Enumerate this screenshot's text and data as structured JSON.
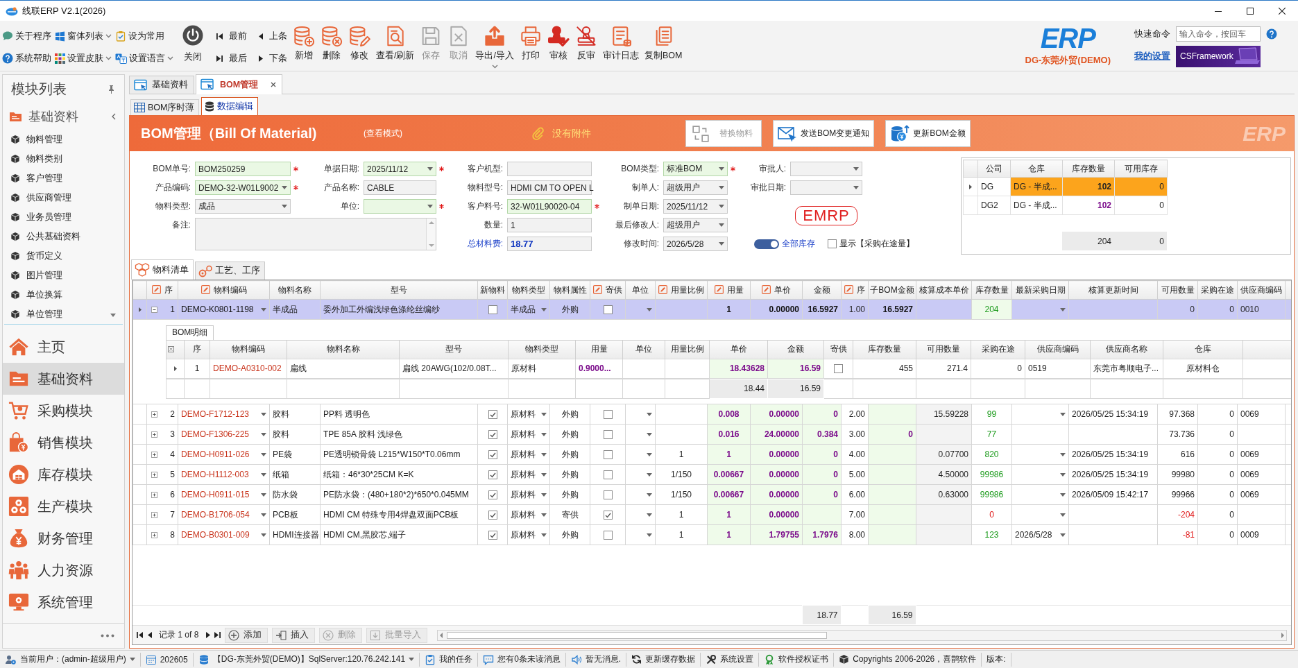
{
  "window": {
    "title": "线联ERP V2.1(2026)"
  },
  "toolbar": {
    "quick_items": [
      {
        "label": "关于程序",
        "dropdown": false
      },
      {
        "label": "窗体列表",
        "dropdown": true
      },
      {
        "label": "设为常用",
        "dropdown": false
      },
      {
        "label": "系统帮助",
        "dropdown": false
      },
      {
        "label": "设置皮肤",
        "dropdown": true
      },
      {
        "label": "设置语言",
        "dropdown": true
      }
    ],
    "close_label": "关闭",
    "navigation": [
      "最前",
      "上条",
      "最后",
      "下条"
    ],
    "actions": [
      {
        "label": "新增",
        "disabled": false,
        "dropdown": false
      },
      {
        "label": "删除",
        "disabled": false,
        "dropdown": false
      },
      {
        "label": "修改",
        "disabled": false,
        "dropdown": false
      },
      {
        "label": "查看/刷新",
        "disabled": false,
        "dropdown": false
      },
      {
        "label": "保存",
        "disabled": true,
        "dropdown": false
      },
      {
        "label": "取消",
        "disabled": true,
        "dropdown": false
      },
      {
        "label": "导出/导入",
        "disabled": false,
        "dropdown": true
      },
      {
        "label": "打印",
        "disabled": false,
        "dropdown": false
      },
      {
        "label": "审核",
        "disabled": false,
        "dropdown": false
      },
      {
        "label": "反审",
        "disabled": false,
        "dropdown": false
      },
      {
        "label": "审计日志",
        "disabled": false,
        "dropdown": false
      },
      {
        "label": "复制BOM",
        "disabled": false,
        "dropdown": false
      }
    ],
    "logo": "ERP",
    "company": "DG-东莞外贸(DEMO)",
    "command_label": "快速命令",
    "command_placeholder": "输入命令，按回车",
    "settings_link": "我的设置",
    "banner": "CSFramework"
  },
  "sidebar": {
    "title": "模块列表",
    "group": "基础资料",
    "items": [
      "物料管理",
      "物料类别",
      "客户管理",
      "供应商管理",
      "业务员管理",
      "公共基础资料",
      "货币定义",
      "图片管理",
      "单位换算",
      "单位管理"
    ],
    "modules": [
      {
        "label": "主页",
        "selected": false
      },
      {
        "label": "基础资料",
        "selected": true
      },
      {
        "label": "采购模块",
        "selected": false
      },
      {
        "label": "销售模块",
        "selected": false
      },
      {
        "label": "库存模块",
        "selected": false
      },
      {
        "label": "生产模块",
        "selected": false
      },
      {
        "label": "财务管理",
        "selected": false
      },
      {
        "label": "人力资源",
        "selected": false
      },
      {
        "label": "系统管理",
        "selected": false
      }
    ]
  },
  "document_tabs": [
    {
      "label": "基础资料",
      "selected": false,
      "closable": false
    },
    {
      "label": "BOM管理",
      "selected": true,
      "closable": true
    }
  ],
  "view_tabs": [
    {
      "label": "BOM序时薄",
      "selected": false
    },
    {
      "label": "数据编辑",
      "selected": true
    }
  ],
  "header": {
    "title": "BOM管理（Bill Of Material)",
    "mode": "(查看模式)",
    "attachment": "没有附件",
    "buttons": [
      {
        "label": "替换物料",
        "disabled": true
      },
      {
        "label": "发送BOM变更通知",
        "disabled": false
      },
      {
        "label": "更新BOM金额",
        "disabled": false
      }
    ],
    "watermark": "ERP"
  },
  "form": {
    "columns": [
      [
        {
          "label": "BOM单号:",
          "value": "BOM250259",
          "kind": "text",
          "required": true
        },
        {
          "label": "产品编码:",
          "value": "DEMO-32-W01L9002",
          "kind": "select",
          "required": true
        },
        {
          "label": "物料类型:",
          "value": "成品",
          "kind": "select",
          "required": false
        },
        {
          "label": "备注:",
          "kind": "memo",
          "required": false
        }
      ],
      [
        {
          "label": "单据日期:",
          "value": "2025/11/12",
          "kind": "select",
          "required": true
        },
        {
          "label": "产品名称:",
          "value": "CABLE",
          "kind": "text",
          "required": false
        },
        {
          "label": "单位:",
          "kind": "select",
          "required": true
        }
      ],
      [
        {
          "label": "客户机型:",
          "kind": "text",
          "required": false
        },
        {
          "label": "物料型号:",
          "value": "HDMI CM TO OPEN L",
          "kind": "text",
          "required": false
        },
        {
          "label": "客户料号:",
          "value": "32-W01L90020-04",
          "kind": "text",
          "required": true
        },
        {
          "label": "数量:",
          "value": "1",
          "kind": "text",
          "required": false
        },
        {
          "label": "总材料费:",
          "value": "18.77",
          "kind": "total",
          "required": false
        }
      ],
      [
        {
          "label": "BOM类型:",
          "value": "标准BOM",
          "kind": "select",
          "required": true
        },
        {
          "label": "制单人:",
          "value": "超级用户",
          "kind": "select",
          "required": false
        },
        {
          "label": "制单日期:",
          "value": "2025/11/12",
          "kind": "select",
          "required": false
        },
        {
          "label": "最后修改人:",
          "value": "超级用户",
          "kind": "select",
          "required": false
        },
        {
          "label": "修改时间:",
          "value": "2026/5/28",
          "kind": "select",
          "required": false
        }
      ],
      [
        {
          "label": "审批人:",
          "kind": "select",
          "required": false
        },
        {
          "label": "审批日期:",
          "kind": "select",
          "required": false
        }
      ]
    ],
    "logo": "EMRP",
    "stock_toggle": {
      "label": "全部库存",
      "on": true
    },
    "transit_checkbox": {
      "label": "显示【采购在途量】",
      "checked": false
    }
  },
  "stock": {
    "columns": [
      "公司",
      "仓库",
      "库存数量",
      "可用库存"
    ],
    "rows": [
      {
        "company": "DG",
        "warehouse": "DG - 半成...",
        "quantity": "102",
        "available": "0",
        "selected": true
      },
      {
        "company": "DG2",
        "warehouse": "DG - 半成...",
        "quantity": "102",
        "available": "0",
        "selected": false
      }
    ],
    "totals": {
      "quantity": "204",
      "available": "0"
    }
  },
  "grid_tabs": [
    {
      "label": "物料清单",
      "selected": true
    },
    {
      "label": "工艺、工序",
      "selected": false
    }
  ],
  "materials": {
    "columns": [
      {
        "label": "序",
        "editable": true
      },
      {
        "label": "物料编码",
        "editable": true
      },
      {
        "label": "物料名称",
        "editable": false
      },
      {
        "label": "型号",
        "editable": false
      },
      {
        "label": "新物料",
        "editable": false
      },
      {
        "label": "物料类型",
        "editable": false
      },
      {
        "label": "物料属性",
        "editable": false
      },
      {
        "label": "寄供",
        "editable": true
      },
      {
        "label": "单位",
        "editable": false
      },
      {
        "label": "用量比例",
        "editable": true
      },
      {
        "label": "用量",
        "editable": true
      },
      {
        "label": "单价",
        "editable": true
      },
      {
        "label": "金额",
        "editable": false
      },
      {
        "label": "序",
        "editable": true
      },
      {
        "label": "子BOM金额",
        "editable": false
      },
      {
        "label": "核算成本单价",
        "editable": false
      },
      {
        "label": "库存数量",
        "editable": false
      },
      {
        "label": "最新采购日期",
        "editable": false
      },
      {
        "label": "核算更新时间",
        "editable": false
      },
      {
        "label": "可用数量",
        "editable": false
      },
      {
        "label": "采购在途",
        "editable": false
      },
      {
        "label": "供应商编码",
        "editable": false
      }
    ],
    "rows": [
      {
        "seq": "1",
        "code": "DEMO-K0801-1198",
        "name": "半成品",
        "model": "委外加工外编浅绿色涤纶丝编纱",
        "new_material": false,
        "type": "半成品",
        "attribute": "外购",
        "consigned": false,
        "qty": "1",
        "price": "0.00000",
        "amount": "16.5927",
        "order": "1.00",
        "sub_bom_amount": "16.5927",
        "stock": "204",
        "available": "0",
        "in_transit": "0",
        "supplier_code": "0010",
        "stock_alert": false,
        "available_alert": false,
        "date_picker": true,
        "selected": true,
        "expanded": true,
        "details": {
          "tab": "BOM明细",
          "columns": [
            "序",
            "物料编码",
            "物料名称",
            "型号",
            "物料类型",
            "用量",
            "单位",
            "用量比例",
            "单价",
            "金额",
            "寄供",
            "库存数量",
            "可用数量",
            "采购在途",
            "供应商编码",
            "供应商名称",
            "仓库"
          ],
          "rows": [
            {
              "seq": "1",
              "code": "DEMO-A0310-002",
              "name": "扁线",
              "model": "扁线 20AWG(102/0.08T...",
              "type": "原材料",
              "qty": "0.9000...",
              "price": "18.43628",
              "amount": "16.59",
              "consigned": false,
              "stock": "455",
              "available": "271.4",
              "in_transit": "0",
              "supplier_code": "0519",
              "supplier_name": "东莞市粤顺电子...",
              "warehouse": "原材料仓",
              "selected": true
            }
          ],
          "totals": {
            "price": "18.44",
            "amount": "16.59"
          }
        }
      },
      {
        "seq": "2",
        "code": "DEMO-F1712-123",
        "name": "胶料",
        "model": "PP料 透明色",
        "new_material": true,
        "type": "原材料",
        "attribute": "外购",
        "consigned": false,
        "qty": "0.008",
        "price": "0.00000",
        "amount": "0",
        "order": "2.00",
        "cost_price": "15.59228",
        "stock": "99",
        "cost_update_time": "2026/05/25 15:34:19",
        "available": "97.368",
        "in_transit": "0",
        "supplier_code": "0069",
        "stock_alert": false,
        "available_alert": false,
        "date_picker": true,
        "selected": false,
        "expanded": false
      },
      {
        "seq": "3",
        "code": "DEMO-F1306-225",
        "name": "胶料",
        "model": "TPE 85A 胶料 浅绿色",
        "new_material": true,
        "type": "原材料",
        "attribute": "外购",
        "consigned": false,
        "qty": "0.016",
        "price": "24.00000",
        "amount": "0.384",
        "order": "3.00",
        "sub_bom_amount": "0",
        "stock": "77",
        "available": "73.736",
        "in_transit": "0",
        "stock_alert": false,
        "available_alert": false,
        "date_picker": false,
        "selected": false,
        "expanded": false
      },
      {
        "seq": "4",
        "code": "DEMO-H0911-026",
        "name": "PE袋",
        "model": "PE透明锁骨袋 L215*W150*T0.06mm",
        "new_material": true,
        "type": "原材料",
        "attribute": "外购",
        "consigned": false,
        "ratio": "1",
        "qty": "1",
        "price": "0.00000",
        "amount": "0",
        "order": "4.00",
        "cost_price": "0.07700",
        "stock": "820",
        "cost_update_time": "2026/05/25 15:34:19",
        "available": "616",
        "in_transit": "0",
        "supplier_code": "0069",
        "stock_alert": false,
        "available_alert": false,
        "date_picker": true,
        "selected": false,
        "expanded": false
      },
      {
        "seq": "5",
        "code": "DEMO-H1112-003",
        "name": "纸箱",
        "model": "纸箱：46*30*25CM K=K",
        "new_material": true,
        "type": "原材料",
        "attribute": "外购",
        "consigned": false,
        "ratio": "1/150",
        "qty": "0.00667",
        "price": "0.00000",
        "amount": "0",
        "order": "5.00",
        "cost_price": "4.50000",
        "stock": "99986",
        "cost_update_time": "2026/05/25 15:34:19",
        "available": "99980",
        "in_transit": "0",
        "supplier_code": "0069",
        "stock_alert": false,
        "available_alert": false,
        "date_picker": true,
        "selected": false,
        "expanded": false
      },
      {
        "seq": "6",
        "code": "DEMO-H0911-015",
        "name": "防水袋",
        "model": "PE防水袋：(480+180*2)*650*0.045MM",
        "new_material": true,
        "type": "原材料",
        "attribute": "外购",
        "consigned": false,
        "ratio": "1/150",
        "qty": "0.00667",
        "price": "0.00000",
        "amount": "0",
        "order": "6.00",
        "cost_price": "0.63000",
        "stock": "99986",
        "cost_update_time": "2026/05/09 15:42:17",
        "available": "99966",
        "in_transit": "0",
        "supplier_code": "0069",
        "stock_alert": false,
        "available_alert": false,
        "date_picker": true,
        "selected": false,
        "expanded": false
      },
      {
        "seq": "7",
        "code": "DEMO-B1706-054",
        "name": "PCB板",
        "model": "HDMI CM 特殊专用4焊盘双面PCB板",
        "new_material": true,
        "type": "原材料",
        "attribute": "寄供",
        "consigned": true,
        "ratio": "1",
        "qty": "1",
        "price": "0.00000",
        "order": "7.00",
        "stock": "0",
        "available": "-204",
        "in_transit": "0",
        "stock_alert": true,
        "available_alert": true,
        "date_picker": true,
        "selected": false,
        "expanded": false
      },
      {
        "seq": "8",
        "code": "DEMO-B0301-009",
        "name": "HDMI连接器",
        "model": "HDMI CM,黑胶芯,端子",
        "new_material": true,
        "type": "原材料",
        "attribute": "外购",
        "consigned": false,
        "ratio": "1",
        "qty": "1",
        "price": "1.79755",
        "amount": "1.7976",
        "order": "8.00",
        "stock": "123",
        "last_purchase_date": "2026/5/28",
        "available": "-81",
        "in_transit": "0",
        "supplier_code": "0009",
        "stock_alert": false,
        "available_alert": true,
        "date_picker": true,
        "selected": false,
        "expanded": false
      }
    ],
    "totals": {
      "amount": "18.77",
      "sub_bom_amount": "16.59"
    },
    "navigator": {
      "record": "记录 1 of 8",
      "buttons": [
        {
          "label": "添加",
          "disabled": false
        },
        {
          "label": "插入",
          "disabled": false
        },
        {
          "label": "删除",
          "disabled": true
        },
        {
          "label": "批量导入",
          "disabled": true
        }
      ]
    }
  },
  "status_bar": [
    {
      "text": "当前用户：(admin-超级用户)",
      "dropdown": true
    },
    {
      "text": "202605",
      "dropdown": false
    },
    {
      "text": "【DG-东莞外贸(DEMO)】SqlServer:120.76.242.141",
      "dropdown": true
    },
    {
      "text": "我的任务",
      "dropdown": false
    },
    {
      "text": "您有0条未读消息",
      "dropdown": false
    },
    {
      "text": "暂无消息.",
      "dropdown": false
    },
    {
      "text": "更新缓存数据",
      "dropdown": false
    },
    {
      "text": "系统设置",
      "dropdown": false
    },
    {
      "text": "软件授权证书",
      "dropdown": false
    },
    {
      "text": "Copyrights 2006-2026，喜鹊软件",
      "dropdown": false
    },
    {
      "text": "版本:",
      "dropdown": false
    }
  ]
}
